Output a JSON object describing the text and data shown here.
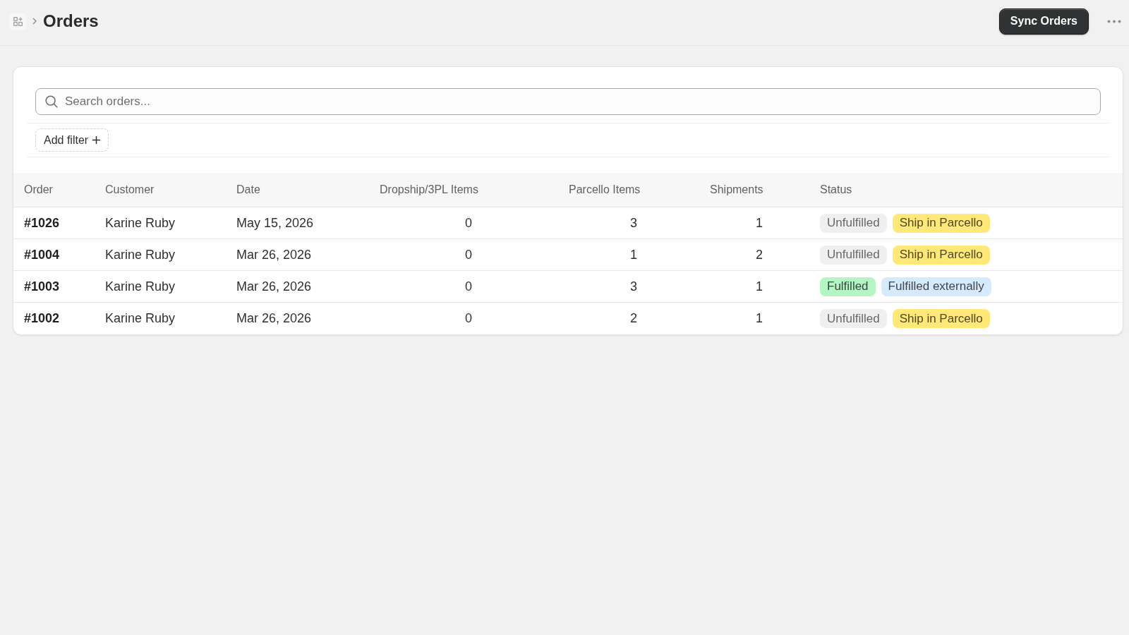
{
  "header": {
    "title": "Orders",
    "primary_action": "Sync Orders"
  },
  "search": {
    "placeholder": "Search orders..."
  },
  "filter_button": {
    "label": "Add filter"
  },
  "table": {
    "columns": [
      {
        "label": "Order",
        "kind": "id"
      },
      {
        "label": "Customer",
        "kind": "text"
      },
      {
        "label": "Date",
        "kind": "text"
      },
      {
        "label": "Dropship/3PL Items",
        "kind": "number"
      },
      {
        "label": "Parcello Items",
        "kind": "number"
      },
      {
        "label": "Shipments",
        "kind": "number"
      },
      {
        "label": "Status",
        "kind": "tags"
      }
    ],
    "rows": [
      {
        "cells": [
          "#1026",
          "Karine Ruby",
          "May 15, 2026",
          "0",
          "3",
          "1"
        ],
        "status": [
          {
            "label": "Unfulfilled",
            "color": "#efefef"
          },
          {
            "label": "Ship in Parcello",
            "color": "#ffe878"
          }
        ]
      },
      {
        "cells": [
          "#1004",
          "Karine Ruby",
          "Mar 26, 2026",
          "0",
          "1",
          "2"
        ],
        "status": [
          {
            "label": "Unfulfilled",
            "color": "#efefef"
          },
          {
            "label": "Ship in Parcello",
            "color": "#ffe878"
          }
        ]
      },
      {
        "cells": [
          "#1003",
          "Karine Ruby",
          "Mar 26, 2026",
          "0",
          "3",
          "1"
        ],
        "status": [
          {
            "label": "Fulfilled",
            "color": "#b4f5c4"
          },
          {
            "label": "Fulfilled externally",
            "color": "#d6eaff"
          }
        ]
      },
      {
        "cells": [
          "#1002",
          "Karine Ruby",
          "Mar 26, 2026",
          "0",
          "2",
          "1"
        ],
        "status": [
          {
            "label": "Unfulfilled",
            "color": "#efefef"
          },
          {
            "label": "Ship in Parcello",
            "color": "#ffe878"
          }
        ]
      }
    ]
  }
}
